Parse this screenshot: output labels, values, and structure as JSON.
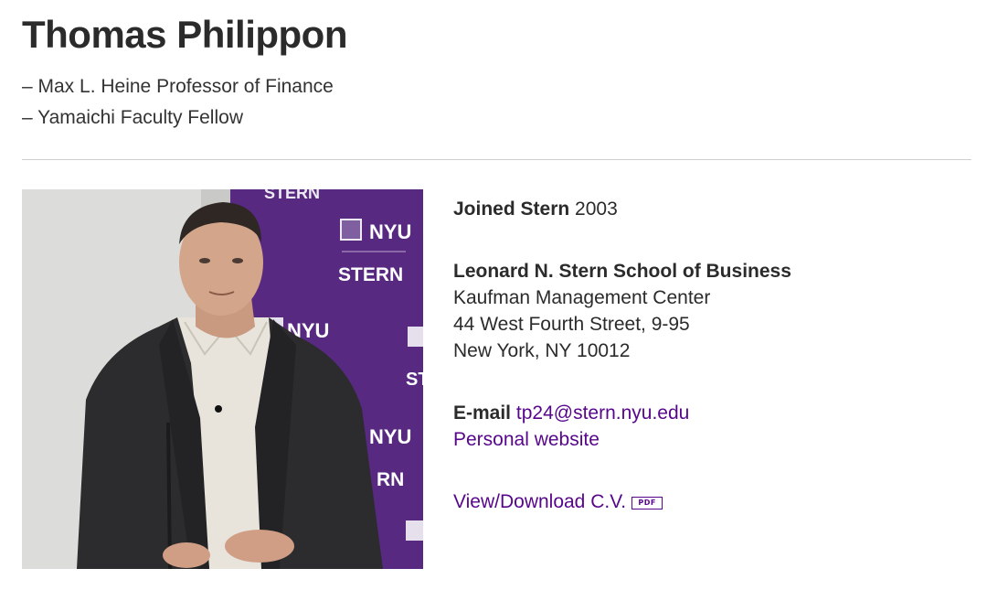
{
  "profile": {
    "name": "Thomas Philippon",
    "titles": [
      "– Max L. Heine Professor of Finance",
      "– Yamaichi Faculty Fellow"
    ]
  },
  "photo": {
    "banner_text_1": "NYU",
    "banner_text_2": "STERN",
    "banner_text_3": "NYU",
    "banner_text_4": "NYU",
    "banner_text_5": "RN",
    "banner_text_6": "ST",
    "banner_text_7": "STERN",
    "banner_color": "#5b2d86"
  },
  "info": {
    "joined_label": "Joined Stern",
    "joined_year": "2003",
    "school_name": "Leonard N. Stern School of Business",
    "address_line1": "Kaufman Management Center",
    "address_line2": "44 West Fourth Street, 9-95",
    "address_line3": "New York, NY 10012",
    "email_label": "E-mail",
    "email": "tp24@stern.nyu.edu",
    "website_label": "Personal website",
    "cv_label": "View/Download C.V.",
    "cv_badge": "PDF"
  },
  "colors": {
    "link": "#57068c",
    "text": "#2b2b2b",
    "divider": "#cfcfcf"
  }
}
